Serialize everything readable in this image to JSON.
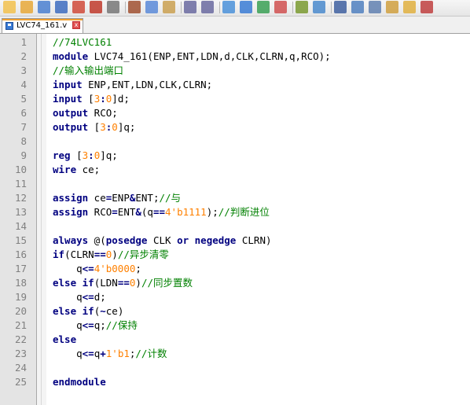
{
  "toolbar": {
    "icons": [
      "new-file-icon",
      "open-file-icon",
      "save-icon",
      "save-all-icon",
      "close-icon",
      "close-all-icon",
      "print-icon",
      "cut-icon",
      "copy-icon",
      "paste-icon",
      "undo-icon",
      "redo-icon",
      "find-icon",
      "replace-icon",
      "zoom-in-icon",
      "zoom-out-icon",
      "sync-v-icon",
      "sync-h-icon",
      "word-wrap-icon",
      "show-all-chars-icon",
      "indent-guide-icon",
      "doc-map-icon",
      "folder-icon",
      "record-macro-icon"
    ]
  },
  "tab": {
    "label": "LVC74_161.v",
    "close_glyph": "x"
  },
  "editor": {
    "lines": [
      {
        "n": "1",
        "tokens": [
          {
            "t": "//74LVC161",
            "c": "cm"
          }
        ]
      },
      {
        "n": "2",
        "tokens": [
          {
            "t": "module",
            "c": "kw"
          },
          {
            "t": " LVC74_161(ENP,ENT,LDN,d,CLK,CLRN,q,RCO);",
            "c": ""
          }
        ]
      },
      {
        "n": "3",
        "tokens": [
          {
            "t": "//输入输出端口",
            "c": "cm"
          }
        ]
      },
      {
        "n": "4",
        "tokens": [
          {
            "t": "input",
            "c": "kw"
          },
          {
            "t": " ENP,ENT,LDN,CLK,CLRN;",
            "c": ""
          }
        ]
      },
      {
        "n": "5",
        "tokens": [
          {
            "t": "input",
            "c": "kw"
          },
          {
            "t": " [",
            "c": ""
          },
          {
            "t": "3",
            "c": "num"
          },
          {
            "t": ":",
            "c": "op"
          },
          {
            "t": "0",
            "c": "num"
          },
          {
            "t": "]d;",
            "c": ""
          }
        ]
      },
      {
        "n": "6",
        "tokens": [
          {
            "t": "output",
            "c": "kw"
          },
          {
            "t": " RCO;",
            "c": ""
          }
        ]
      },
      {
        "n": "7",
        "tokens": [
          {
            "t": "output",
            "c": "kw"
          },
          {
            "t": " [",
            "c": ""
          },
          {
            "t": "3",
            "c": "num"
          },
          {
            "t": ":",
            "c": "op"
          },
          {
            "t": "0",
            "c": "num"
          },
          {
            "t": "]q;",
            "c": ""
          }
        ]
      },
      {
        "n": "8",
        "tokens": []
      },
      {
        "n": "9",
        "tokens": [
          {
            "t": "reg",
            "c": "kw"
          },
          {
            "t": " [",
            "c": ""
          },
          {
            "t": "3",
            "c": "num"
          },
          {
            "t": ":",
            "c": "op"
          },
          {
            "t": "0",
            "c": "num"
          },
          {
            "t": "]q;",
            "c": ""
          }
        ]
      },
      {
        "n": "10",
        "tokens": [
          {
            "t": "wire",
            "c": "kw"
          },
          {
            "t": " ce;",
            "c": ""
          }
        ]
      },
      {
        "n": "11",
        "tokens": []
      },
      {
        "n": "12",
        "tokens": [
          {
            "t": "assign",
            "c": "kw"
          },
          {
            "t": " ce",
            "c": ""
          },
          {
            "t": "=",
            "c": "op"
          },
          {
            "t": "ENP",
            "c": ""
          },
          {
            "t": "&",
            "c": "op"
          },
          {
            "t": "ENT;",
            "c": ""
          },
          {
            "t": "//与",
            "c": "cm"
          }
        ]
      },
      {
        "n": "13",
        "tokens": [
          {
            "t": "assign",
            "c": "kw"
          },
          {
            "t": " RCO",
            "c": ""
          },
          {
            "t": "=",
            "c": "op"
          },
          {
            "t": "ENT",
            "c": ""
          },
          {
            "t": "&",
            "c": "op"
          },
          {
            "t": "(q",
            "c": ""
          },
          {
            "t": "==",
            "c": "op"
          },
          {
            "t": "4'b1111",
            "c": "num"
          },
          {
            "t": ");",
            "c": ""
          },
          {
            "t": "//判断进位",
            "c": "cm"
          }
        ]
      },
      {
        "n": "14",
        "tokens": []
      },
      {
        "n": "15",
        "tokens": [
          {
            "t": "always",
            "c": "kw"
          },
          {
            "t": " @(",
            "c": ""
          },
          {
            "t": "posedge",
            "c": "kw"
          },
          {
            "t": " CLK ",
            "c": ""
          },
          {
            "t": "or",
            "c": "kw"
          },
          {
            "t": " ",
            "c": ""
          },
          {
            "t": "negedge",
            "c": "kw"
          },
          {
            "t": " CLRN)",
            "c": ""
          }
        ]
      },
      {
        "n": "16",
        "tokens": [
          {
            "t": "if",
            "c": "kw"
          },
          {
            "t": "(CLRN",
            "c": ""
          },
          {
            "t": "==",
            "c": "op"
          },
          {
            "t": "0",
            "c": "num"
          },
          {
            "t": ")",
            "c": ""
          },
          {
            "t": "//异步清零",
            "c": "cm"
          }
        ]
      },
      {
        "n": "17",
        "tokens": [
          {
            "t": "    q",
            "c": ""
          },
          {
            "t": "<=",
            "c": "op"
          },
          {
            "t": "4'b0000",
            "c": "num"
          },
          {
            "t": ";",
            "c": ""
          }
        ]
      },
      {
        "n": "18",
        "tokens": [
          {
            "t": "else",
            "c": "kw"
          },
          {
            "t": " ",
            "c": ""
          },
          {
            "t": "if",
            "c": "kw"
          },
          {
            "t": "(LDN",
            "c": ""
          },
          {
            "t": "==",
            "c": "op"
          },
          {
            "t": "0",
            "c": "num"
          },
          {
            "t": ")",
            "c": ""
          },
          {
            "t": "//同步置数",
            "c": "cm"
          }
        ]
      },
      {
        "n": "19",
        "tokens": [
          {
            "t": "    q",
            "c": ""
          },
          {
            "t": "<=",
            "c": "op"
          },
          {
            "t": "d;",
            "c": ""
          }
        ]
      },
      {
        "n": "20",
        "tokens": [
          {
            "t": "else",
            "c": "kw"
          },
          {
            "t": " ",
            "c": ""
          },
          {
            "t": "if",
            "c": "kw"
          },
          {
            "t": "(",
            "c": ""
          },
          {
            "t": "~",
            "c": "op"
          },
          {
            "t": "ce)",
            "c": ""
          }
        ]
      },
      {
        "n": "21",
        "tokens": [
          {
            "t": "    q",
            "c": ""
          },
          {
            "t": "<=",
            "c": "op"
          },
          {
            "t": "q;",
            "c": ""
          },
          {
            "t": "//保持",
            "c": "cm"
          }
        ]
      },
      {
        "n": "22",
        "tokens": [
          {
            "t": "else",
            "c": "kw"
          }
        ]
      },
      {
        "n": "23",
        "tokens": [
          {
            "t": "    q",
            "c": ""
          },
          {
            "t": "<=",
            "c": "op"
          },
          {
            "t": "q",
            "c": ""
          },
          {
            "t": "+",
            "c": "op"
          },
          {
            "t": "1'b1",
            "c": "num"
          },
          {
            "t": ";",
            "c": ""
          },
          {
            "t": "//计数",
            "c": "cm"
          }
        ]
      },
      {
        "n": "24",
        "tokens": []
      },
      {
        "n": "25",
        "tokens": [
          {
            "t": "endmodule",
            "c": "kw"
          }
        ]
      }
    ]
  },
  "colors": {
    "keyword": "#000080",
    "comment": "#008000",
    "number": "#ff8000",
    "tab_accent": "#f0a030"
  }
}
